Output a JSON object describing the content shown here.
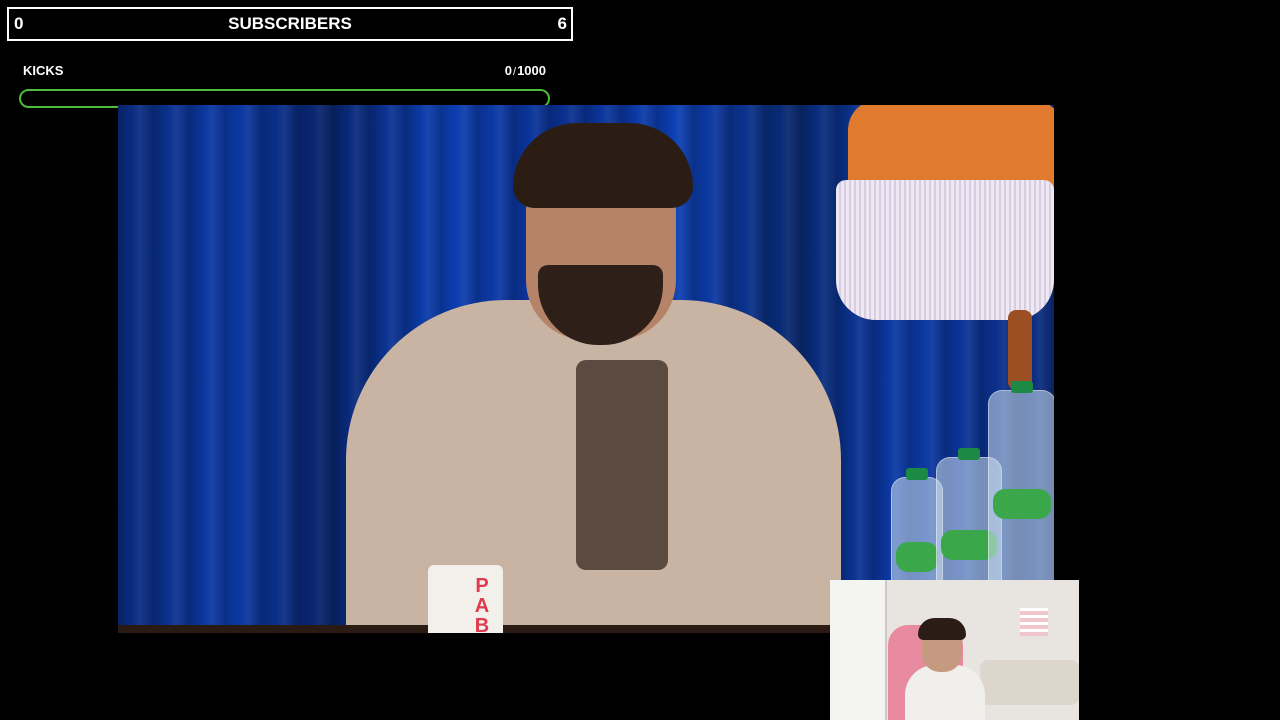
{
  "subscribers": {
    "left_value": "0",
    "title": "SUBSCRIBERS",
    "right_value": "6"
  },
  "kicks": {
    "label": "KICKS",
    "current": "0",
    "separator": "/",
    "goal": "1000",
    "progress_fraction": 0
  },
  "video": {
    "cup_text": "PAB"
  },
  "colors": {
    "background": "#000000",
    "progress_border": "#4cbc3a",
    "text": "#ffffff"
  }
}
